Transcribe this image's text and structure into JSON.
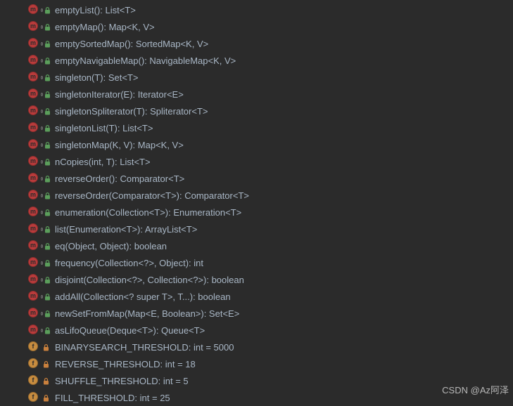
{
  "watermark": "CSDN @Az阿泽",
  "icons": {
    "method": "m",
    "field": "f"
  },
  "colors": {
    "lock_public": "#5b9e5b",
    "lock_private": "#c9803d",
    "dot_border": "#7a7a7a"
  },
  "members": [
    {
      "kind": "method",
      "visibility": "public",
      "has_dot": true,
      "signature": "emptyList(): List<T>"
    },
    {
      "kind": "method",
      "visibility": "public",
      "has_dot": true,
      "signature": "emptyMap(): Map<K, V>"
    },
    {
      "kind": "method",
      "visibility": "public",
      "has_dot": true,
      "signature": "emptySortedMap(): SortedMap<K, V>"
    },
    {
      "kind": "method",
      "visibility": "public",
      "has_dot": true,
      "signature": "emptyNavigableMap(): NavigableMap<K, V>"
    },
    {
      "kind": "method",
      "visibility": "public",
      "has_dot": true,
      "signature": "singleton(T): Set<T>"
    },
    {
      "kind": "method",
      "visibility": "public",
      "has_dot": true,
      "signature": "singletonIterator(E): Iterator<E>"
    },
    {
      "kind": "method",
      "visibility": "public",
      "has_dot": true,
      "signature": "singletonSpliterator(T): Spliterator<T>"
    },
    {
      "kind": "method",
      "visibility": "public",
      "has_dot": true,
      "signature": "singletonList(T): List<T>"
    },
    {
      "kind": "method",
      "visibility": "public",
      "has_dot": true,
      "signature": "singletonMap(K, V): Map<K, V>"
    },
    {
      "kind": "method",
      "visibility": "public",
      "has_dot": true,
      "signature": "nCopies(int, T): List<T>"
    },
    {
      "kind": "method",
      "visibility": "public",
      "has_dot": true,
      "signature": "reverseOrder(): Comparator<T>"
    },
    {
      "kind": "method",
      "visibility": "public",
      "has_dot": true,
      "signature": "reverseOrder(Comparator<T>): Comparator<T>"
    },
    {
      "kind": "method",
      "visibility": "public",
      "has_dot": true,
      "signature": "enumeration(Collection<T>): Enumeration<T>"
    },
    {
      "kind": "method",
      "visibility": "public",
      "has_dot": true,
      "signature": "list(Enumeration<T>): ArrayList<T>"
    },
    {
      "kind": "method",
      "visibility": "public",
      "has_dot": true,
      "signature": "eq(Object, Object): boolean"
    },
    {
      "kind": "method",
      "visibility": "public",
      "has_dot": true,
      "signature": "frequency(Collection<?>, Object): int"
    },
    {
      "kind": "method",
      "visibility": "public",
      "has_dot": true,
      "signature": "disjoint(Collection<?>, Collection<?>): boolean"
    },
    {
      "kind": "method",
      "visibility": "public",
      "has_dot": true,
      "signature": "addAll(Collection<? super T>, T...): boolean"
    },
    {
      "kind": "method",
      "visibility": "public",
      "has_dot": true,
      "signature": "newSetFromMap(Map<E, Boolean>): Set<E>"
    },
    {
      "kind": "method",
      "visibility": "public",
      "has_dot": true,
      "signature": "asLifoQueue(Deque<T>): Queue<T>"
    },
    {
      "kind": "field",
      "visibility": "private",
      "has_dot": false,
      "signature": "BINARYSEARCH_THRESHOLD: int = 5000"
    },
    {
      "kind": "field",
      "visibility": "private",
      "has_dot": false,
      "signature": "REVERSE_THRESHOLD: int = 18"
    },
    {
      "kind": "field",
      "visibility": "private",
      "has_dot": false,
      "signature": "SHUFFLE_THRESHOLD: int = 5"
    },
    {
      "kind": "field",
      "visibility": "private",
      "has_dot": false,
      "signature": "FILL_THRESHOLD: int = 25"
    }
  ]
}
